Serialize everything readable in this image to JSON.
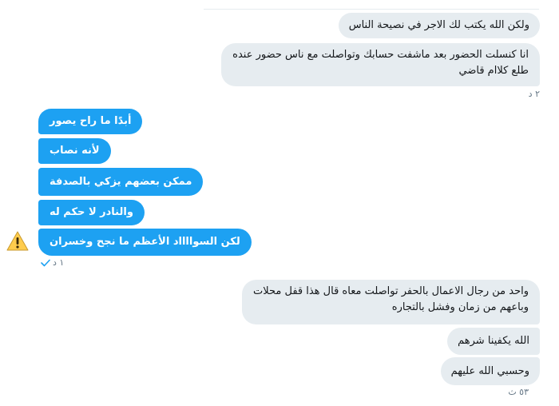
{
  "conversation": {
    "incoming_top": [
      "ولكن الله يكتب لك الاجر في نصيحة الناس",
      "انا كنسلت الحضور بعد ماشفت حسابك وتواصلت مع ناس حضور عنده",
      "طلع كلاام قاضي"
    ],
    "incoming_top_time": "٢ د",
    "outgoing": [
      "أبدًا ما راح يصور",
      "لأنه نصاب",
      "ممكن بعضهم يزكي بالصدفة",
      "والنادر لا حكم له",
      "لكن السوااااد الأعظم ما نجح وخسران"
    ],
    "outgoing_time": "١ د",
    "outgoing_status_icon": "warning-icon",
    "outgoing_read_icon": "checkmark-icon",
    "incoming_bottom": [
      "واحد من رجال الاعمال بالحفر تواصلت معاه قال هذا قفل محلات",
      "وباعهم من زمان وفشل بالتجاره",
      "الله يكفينا شرهم",
      "وحسبي الله عليهم"
    ],
    "incoming_bottom_time": "٥٣ ث"
  },
  "colors": {
    "incoming_bubble": "#e6ecf0",
    "outgoing_bubble": "#1da1f2",
    "timestamp": "#657786",
    "warning": "#ffcc4d"
  }
}
